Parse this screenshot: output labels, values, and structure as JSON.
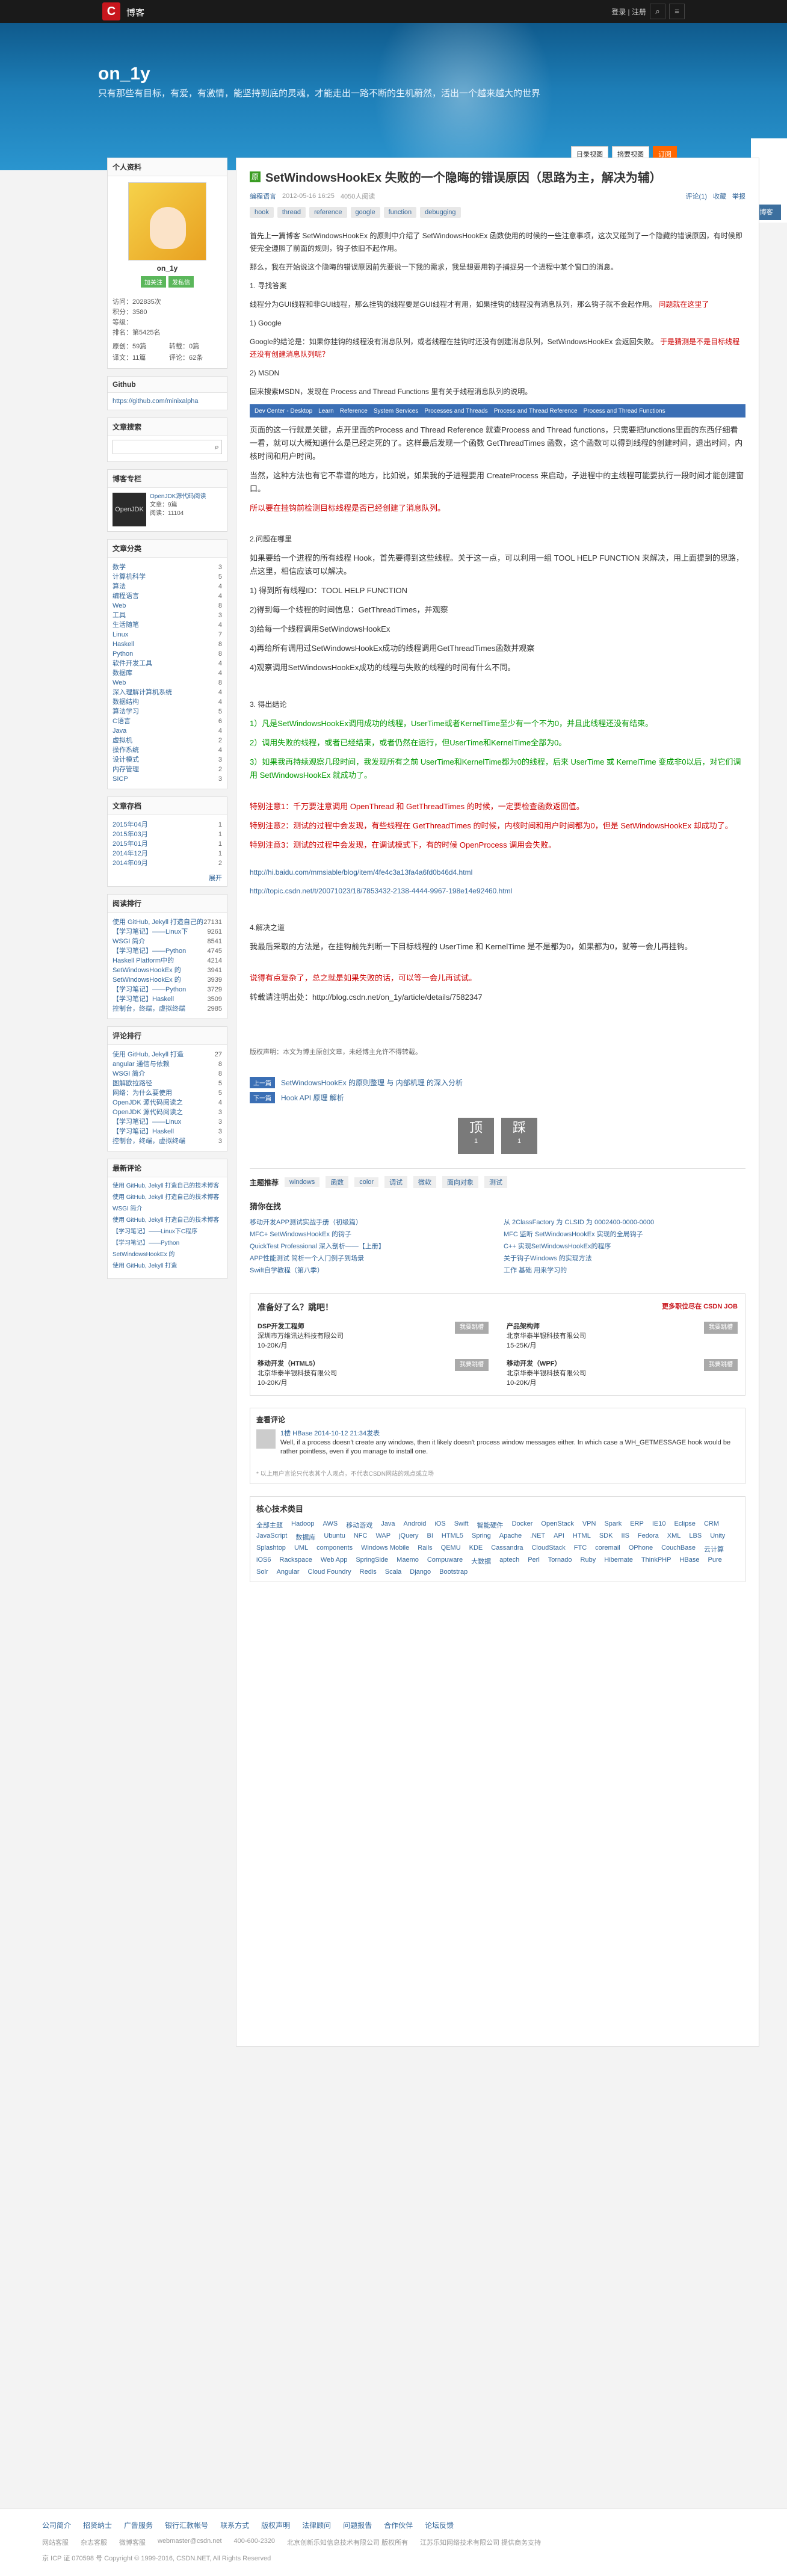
{
  "topbar": {
    "logo": "C",
    "brand": "博客",
    "user_links": "登录 | 注册"
  },
  "banner": {
    "title": "on_1y",
    "motto": "只有那些有目标，有爱，有激情，能坚持到底的灵魂，才能走出一路不断的生机蔚然，活出一个越来越大的世界",
    "btn1": "目录视图",
    "btn2": "摘要视图",
    "btn3": "订阅"
  },
  "favorite": "收藏到博客",
  "profile": {
    "header": "个人资料",
    "name": "on_1y",
    "follow": "加关注",
    "msg": "发私信",
    "visits": "访问：202835次",
    "points": "积分：3580",
    "level": "等级：",
    "rank": "排名：第5425名",
    "original": "原创：59篇",
    "reprint": "转载：0篇",
    "translate": "译文：11篇",
    "comments": "评论：62条"
  },
  "github": {
    "header": "Github",
    "url": "https://github.com/minixalpha"
  },
  "search": {
    "header": "文章搜索"
  },
  "column": {
    "header": "博客专栏",
    "name": "OpenJDK",
    "desc": "OpenJDK源代码阅读",
    "articles": "文章：9篇",
    "reads": "阅读：11104"
  },
  "categories": {
    "header": "文章分类",
    "items": [
      [
        "数学",
        "3"
      ],
      [
        "计算机科学",
        "5"
      ],
      [
        "算法",
        "4"
      ],
      [
        "编程语言",
        "4"
      ],
      [
        "Web",
        "8"
      ],
      [
        "工具",
        "3"
      ],
      [
        "生活随笔",
        "4"
      ],
      [
        "Linux",
        "7"
      ],
      [
        "Haskell",
        "8"
      ],
      [
        "Python",
        "8"
      ],
      [
        "软件开发工具",
        "4"
      ],
      [
        "数据库",
        "4"
      ],
      [
        "Web",
        "8"
      ],
      [
        "深入理解计算机系统",
        "4"
      ],
      [
        "数据结构",
        "4"
      ],
      [
        "算法学习",
        "5"
      ],
      [
        "C语言",
        "6"
      ],
      [
        "Java",
        "4"
      ],
      [
        "虚拟机",
        "2"
      ],
      [
        "操作系统",
        "4"
      ],
      [
        "设计模式",
        "3"
      ],
      [
        "内存管理",
        "2"
      ],
      [
        "SICP",
        "3"
      ]
    ]
  },
  "archive": {
    "header": "文章存档",
    "items": [
      [
        "2015年04月",
        "1"
      ],
      [
        "2015年03月",
        "1"
      ],
      [
        "2015年01月",
        "1"
      ],
      [
        "2014年12月",
        "1"
      ],
      [
        "2014年09月",
        "2"
      ]
    ],
    "more": "展开"
  },
  "reads": {
    "header": "阅读排行",
    "items": [
      [
        "使用 GitHub, Jekyll 打造自己的",
        "27131"
      ],
      [
        "【学习笔记】——Linux下",
        "9261"
      ],
      [
        "WSGI 简介",
        "8541"
      ],
      [
        "【学习笔记】——Python",
        "4745"
      ],
      [
        "Haskell Platform中的",
        "4214"
      ],
      [
        "SetWindowsHookEx 的",
        "3941"
      ],
      [
        "SetWindowsHookEx 的",
        "3939"
      ],
      [
        "【学习笔记】——Python",
        "3729"
      ],
      [
        "【学习笔记】Haskell",
        "3509"
      ],
      [
        "控制台，终端，虚拟终端",
        "2985"
      ]
    ]
  },
  "comments_rank": {
    "header": "评论排行",
    "items": [
      [
        "使用 GitHub, Jekyll 打造",
        "27"
      ],
      [
        "angular 通信与依赖",
        "8"
      ],
      [
        "WSGI 简介",
        "8"
      ],
      [
        "图解欧拉路径",
        "5"
      ],
      [
        "网络：为什么要使用",
        "5"
      ],
      [
        "OpenJDK 源代码阅读之",
        "4"
      ],
      [
        "OpenJDK 源代码阅读之",
        "3"
      ],
      [
        "【学习笔记】——Linux",
        "3"
      ],
      [
        "【学习笔记】Haskell",
        "3"
      ],
      [
        "控制台，终端，虚拟终端",
        "3"
      ]
    ]
  },
  "latest_comments": {
    "header": "最新评论",
    "items": [
      "使用 GitHub, Jekyll 打造自己的技术博客",
      "使用 GitHub, Jekyll 打造自己的技术博客",
      "WSGI 简介",
      "使用 GitHub, Jekyll 打造自己的技术博客",
      "【学习笔记】——Linux下C程序",
      "【学习笔记】——Python",
      "SetWindowsHookEx 的",
      "使用 GitHub, Jekyll 打造"
    ]
  },
  "post": {
    "title": "SetWindowsHookEx 失败的一个隐晦的错误原因（思路为主，解决为辅）",
    "author": "编程语言",
    "date": "2012-05-16 16:25",
    "views": "4050人阅读",
    "comments": "评论(1)",
    "collect": "收藏",
    "report": "举报",
    "tags": [
      "hook",
      "thread",
      "reference",
      "google",
      "function",
      "debugging"
    ]
  },
  "content": {
    "p1": "首先上一篇博客 SetWindowsHookEx 的原则中介绍了 SetWindowsHookEx 函数使用的时候的一些注意事项，这次又碰到了一个隐藏的错误原因，有时候即使完全遵照了前面的规则，钩子依旧不起作用。",
    "p2": "那么，我在开始说这个隐晦的错误原因前先要说一下我的需求，我是想要用钩子捕捉另一个进程中某个窗口的消息。",
    "s1": "1. 寻找答案",
    "p3": "线程分为GUI线程和非GUI线程，那么挂钩的线程要是GUI线程才有用，如果挂钩的线程没有消息队列，那么钩子就不会起作用。",
    "red1": "问题就在这里了",
    "s2": "1) Google",
    "p4": "Google的结论是：如果你挂钩的线程没有消息队列，或者线程在挂钩时还没有创建消息队列，SetWindowsHookEx 会返回失败。",
    "red2": "于是猜测是不是目标线程还没有创建消息队列呢？",
    "s3": "2) MSDN",
    "p5": "回来搜索MSDN，发现在 Process and Thread Functions 里有关于线程消息队列的说明。",
    "nav": [
      "Dev Center - Desktop",
      "Learn",
      "Reference",
      "System Services",
      "Processes and Threads",
      "Process and Thread Reference",
      "Process and Thread Functions"
    ],
    "p6": "页面的这一行就是关键，点开里面的Process and Thread Reference 就查Process and Thread functions，只需要把functions里面的东西仔细看一看，就可以大概知道什么是已经定死的了。这样最后发现一个函数 GetThreadTimes 函数，这个函数可以得到线程的创建时间，退出时间，内核时间和用户时间。",
    "p7": "当然，这种方法也有它不靠谱的地方，比如说，如果我的子进程要用 CreateProcess 来启动，子进程中的主线程可能要执行一段时间才能创建窗口。",
    "red3": "所以要在挂钩前检测目标线程是否已经创建了消息队列。",
    "s4": "2.问题在哪里",
    "p8": "如果要给一个进程的所有线程 Hook，首先要得到这些线程。关于这一点，可以利用一组 TOOL HELP FUNCTION 来解决，用上面提到的思路，点这里，相信应该可以解决。",
    "li1": "1) 得到所有线程ID：TOOL HELP FUNCTION",
    "li2": "2)得到每一个线程的时间信息：GetThreadTimes，并观察",
    "li3": "3)给每一个线程调用SetWindowsHookEx",
    "li4": "4)再给所有调用过SetWindowsHookEx成功的线程调用GetThreadTimes函数并观察",
    "li5": "4)观察调用SetWindowsHookEx成功的线程与失败的线程的时间有什么不同。",
    "s5": "3. 得出结论",
    "g1": "1）凡是SetWindowsHookEx调用成功的线程，UserTime或者KernelTime至少有一个不为0，并且此线程还没有结束。",
    "g2": "2）调用失败的线程，或者已经结束，或者仍然在运行，但UserTime和KernelTime全部为0。",
    "g3": "3）如果我再持续观察几段时间，我发现所有之前 UserTime和KernelTime都为0的线程，后来 UserTime 或 KernelTime 变成非0以后，对它们调用 SetWindowsHookEx 就成功了。",
    "r1": "特别注意1：千万要注意调用 OpenThread 和 GetThreadTimes 的时候，一定要检查函数返回值。",
    "r2": "特别注意2：测试的过程中会发现，有些线程在 GetThreadTimes 的时候，内核时间和用户时间都为0，但是 SetWindowsHookEx 却成功了。",
    "r3": "特别注意3：测试的过程中会发现，在调试模式下，有的时候 OpenProcess 调用会失败。",
    "url1": "http://hi.baidu.com/mmsiable/blog/item/4fe4c3a13fa4a6fd0b46d4.html",
    "url2": "http://topic.csdn.net/t/20071023/18/7853432-2138-4444-9967-198e14e92460.html",
    "s6": "4.解决之道",
    "p9": "我最后采取的方法是，在挂钩前先判断一下目标线程的 UserTime 和 KernelTime 是不是都为0，如果都为0，就等一会儿再挂钩。",
    "red4": "说得有点复杂了，总之就是如果失败的话，可以等一会儿再试试。",
    "p10": "转载请注明出处：http://blog.csdn.net/on_1y/article/details/7582347",
    "copyright": "版权声明：本文为博主原创文章，未经博主允许不得转载。"
  },
  "prevnext": {
    "prev_label": "上一篇",
    "prev": "SetWindowsHookEx 的原则整理 与 内部机理 的深入分析",
    "next_label": "下一篇",
    "next": "Hook API 原理 解析"
  },
  "dingcai": {
    "ding": "顶",
    "ding_n": "1",
    "cai": "踩",
    "cai_n": "1"
  },
  "topics": {
    "label": "主题推荐",
    "items": [
      "windows",
      "函数",
      "color",
      "调试",
      "微软",
      "面向对象",
      "测试"
    ]
  },
  "recommend": {
    "header": "猜你在找",
    "items": [
      "移动开发APP测试实战手册（初级篇）",
      "从 2ClassFactory 为 CLSID 为 0002400-0000-0000",
      "MFC+ SetWindowsHookEx 的钩子",
      "MFC 监听 SetWindowsHookEx 实现的全局钩子",
      "QuickTest Professional 深入剖析——【上册】",
      "C++ 实现SetWindowsHookEx的程序",
      "APP性能测试 简析一个人门例子到场景",
      "关于钩子Windows 的实现方法",
      "Swift自学教程（第八季）",
      "工作 基础 用来学习的"
    ]
  },
  "jobs": {
    "header": "准备好了么？跳吧！",
    "site": "更多职位尽在 CSDN JOB",
    "items": [
      {
        "title": "DSP开发工程师",
        "company": "深圳市万维讯达科技有限公司",
        "salary": "10-20K/月",
        "apply": "我要跳槽"
      },
      {
        "title": "产品架构师",
        "company": "北京华泰半银科技有限公司",
        "salary": "15-25K/月",
        "apply": "我要跳槽"
      },
      {
        "title": "移动开发（HTML5）",
        "company": "北京华泰半银科技有限公司",
        "salary": "10-20K/月",
        "apply": "我要跳槽"
      },
      {
        "title": "移动开发（WPF）",
        "company": "北京华泰半银科技有限公司",
        "salary": "10-20K/月",
        "apply": "我要跳槽"
      }
    ]
  },
  "cmts": {
    "header": "查看评论",
    "author": "1楼 HBase 2014-10-12 21:34发表",
    "text": "Well, if a process doesn't create any windows, then it likely doesn't process window messages either. In which case a WH_GETMESSAGE hook would be rather pointless, even if you manage to install one.",
    "note": "* 以上用户言论只代表其个人观点，不代表CSDN网站的观点或立场"
  },
  "core": {
    "header": "核心技术类目",
    "words": [
      "全部主题",
      "Hadoop",
      "AWS",
      "移动游戏",
      "Java",
      "Android",
      "iOS",
      "Swift",
      "智能硬件",
      "Docker",
      "OpenStack",
      "VPN",
      "Spark",
      "ERP",
      "IE10",
      "Eclipse",
      "CRM",
      "JavaScript",
      "数据库",
      "Ubuntu",
      "NFC",
      "WAP",
      "jQuery",
      "BI",
      "HTML5",
      "Spring",
      "Apache",
      ".NET",
      "API",
      "HTML",
      "SDK",
      "IIS",
      "Fedora",
      "XML",
      "LBS",
      "Unity",
      "Splashtop",
      "UML",
      "components",
      "Windows Mobile",
      "Rails",
      "QEMU",
      "KDE",
      "Cassandra",
      "CloudStack",
      "FTC",
      "coremail",
      "OPhone",
      "CouchBase",
      "云计算",
      "iOS6",
      "Rackspace",
      "Web App",
      "SpringSide",
      "Maemo",
      "Compuware",
      "大数据",
      "aptech",
      "Perl",
      "Tornado",
      "Ruby",
      "Hibernate",
      "ThinkPHP",
      "HBase",
      "Pure",
      "Solr",
      "Angular",
      "Cloud Foundry",
      "Redis",
      "Scala",
      "Django",
      "Bootstrap"
    ]
  },
  "footer": {
    "links": [
      "公司简介",
      "招贤纳士",
      "广告服务",
      "银行汇款帐号",
      "联系方式",
      "版权声明",
      "法律顾问",
      "问题报告",
      "合作伙伴",
      "论坛反馈"
    ],
    "info": [
      "网站客服",
      "杂志客服",
      "微博客服",
      "webmaster@csdn.net",
      "400-600-2320",
      "北京创新乐知信息技术有限公司 版权所有",
      "江苏乐知网络技术有限公司 提供商务支持"
    ],
    "copy": "京 ICP 证 070598 号   Copyright © 1999-2016, CSDN.NET, All Rights Reserved"
  }
}
